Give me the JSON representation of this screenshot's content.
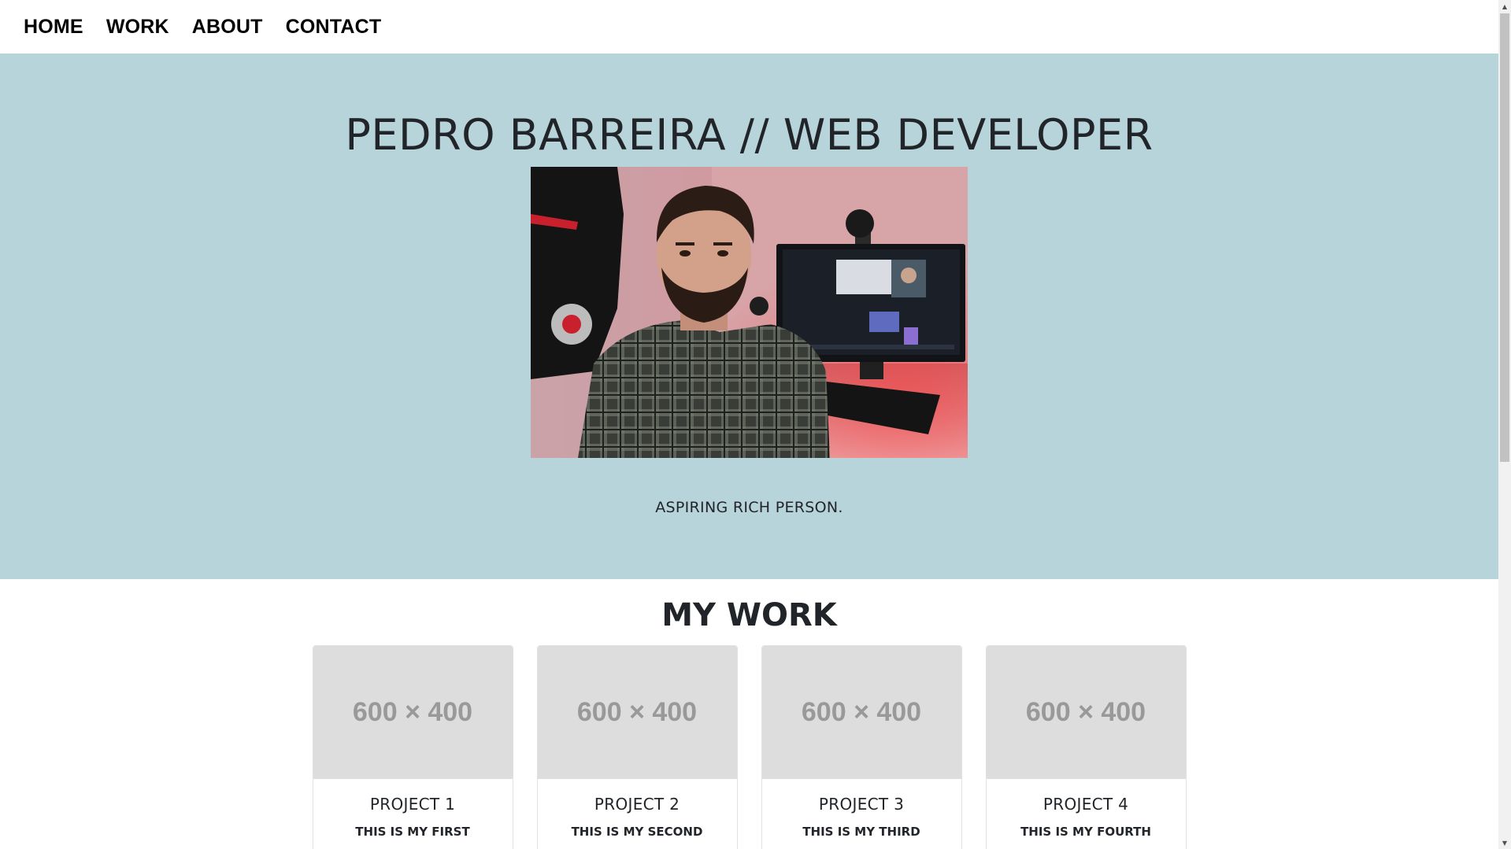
{
  "nav": {
    "items": [
      "HOME",
      "WORK",
      "ABOUT",
      "CONTACT"
    ]
  },
  "hero": {
    "title": "PEDRO BARREIRA // WEB DEVELOPER",
    "tagline": "ASPIRING RICH PERSON.",
    "background_color": "#b8d4db"
  },
  "work": {
    "title": "MY WORK",
    "projects": [
      {
        "thumb": "600 × 400",
        "title": "PROJECT 1",
        "text": "THIS IS MY FIRST"
      },
      {
        "thumb": "600 × 400",
        "title": "PROJECT 2",
        "text": "THIS IS MY SECOND"
      },
      {
        "thumb": "600 × 400",
        "title": "PROJECT 3",
        "text": "THIS IS MY THIRD"
      },
      {
        "thumb": "600 × 400",
        "title": "PROJECT 4",
        "text": "THIS IS MY FOURTH"
      }
    ]
  },
  "scrollbar": {
    "up_icon": "scroll-up-arrow-icon",
    "down_icon": "scroll-down-arrow-icon"
  }
}
